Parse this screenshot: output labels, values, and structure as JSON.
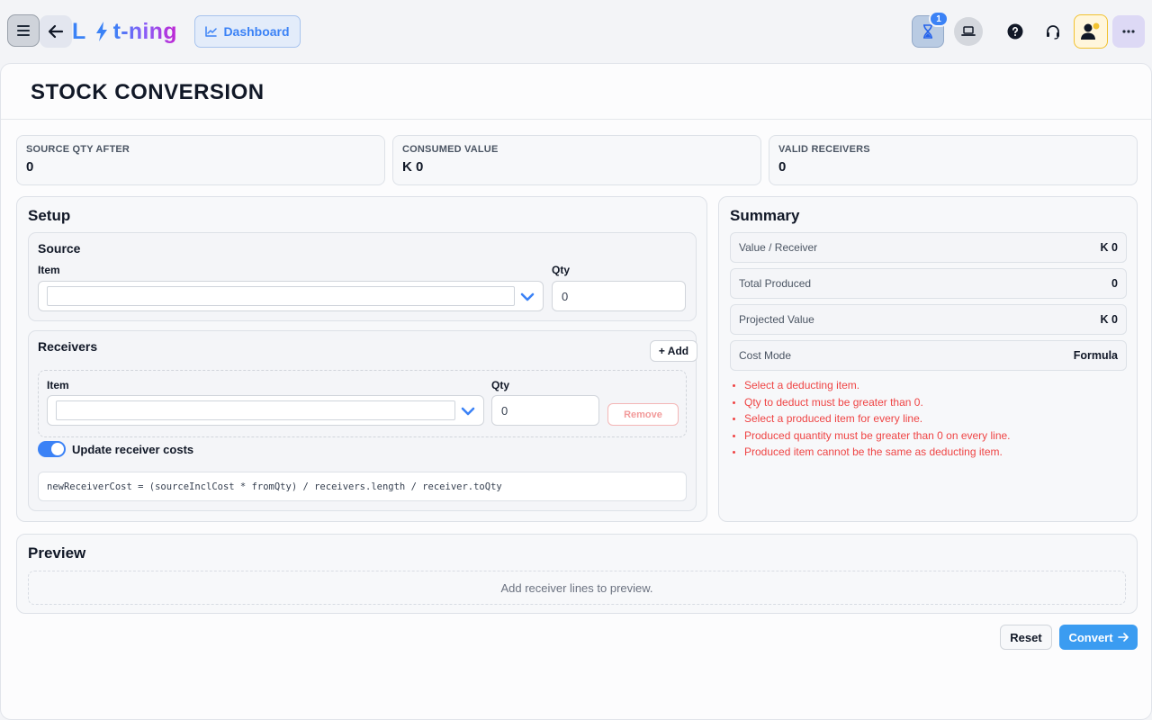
{
  "header": {
    "logo": {
      "left": "L",
      "right": "t-ning"
    },
    "dashboard_label": "Dashboard",
    "notification_count": "1",
    "icons": [
      "menu-icon",
      "back-arrow-icon",
      "bolt-icon",
      "chart-icon",
      "hourglass-icon",
      "laptop-icon",
      "help-icon",
      "headset-icon",
      "user-status-icon",
      "more-icon"
    ]
  },
  "page": {
    "title": "STOCK CONVERSION"
  },
  "stats": [
    {
      "label": "SOURCE QTY AFTER",
      "value": "0"
    },
    {
      "label": "CONSUMED VALUE",
      "value": "K 0"
    },
    {
      "label": "VALID RECEIVERS",
      "value": "0"
    }
  ],
  "setup": {
    "title": "Setup",
    "source": {
      "title": "Source",
      "item_label": "Item",
      "item_value": "",
      "qty_label": "Qty",
      "qty_value": "0"
    },
    "receivers": {
      "title": "Receivers",
      "add_label": "+ Add",
      "line": {
        "item_label": "Item",
        "item_value": "",
        "qty_label": "Qty",
        "qty_value": "0",
        "remove_label": "Remove"
      },
      "toggle_label": "Update receiver costs",
      "toggle_on": true,
      "formula": "newReceiverCost = (sourceInclCost * fromQty) / receivers.length / receiver.toQty"
    }
  },
  "summary": {
    "title": "Summary",
    "rows": [
      {
        "key": "Value / Receiver",
        "value": "K 0"
      },
      {
        "key": "Total Produced",
        "value": "0"
      },
      {
        "key": "Projected Value",
        "value": "K 0"
      },
      {
        "key": "Cost Mode",
        "value": "Formula"
      }
    ],
    "errors": [
      "Select a deducting item.",
      "Qty to deduct must be greater than 0.",
      "Select a produced item for every line.",
      "Produced quantity must be greater than 0 on every line.",
      "Produced item cannot be the same as deducting item."
    ]
  },
  "preview": {
    "title": "Preview",
    "empty_text": "Add receiver lines to preview."
  },
  "actions": {
    "reset_label": "Reset",
    "convert_label": "Convert"
  },
  "colors": {
    "accent": "#3b82f6",
    "error": "#ef4444",
    "warning": "#f2c230"
  }
}
